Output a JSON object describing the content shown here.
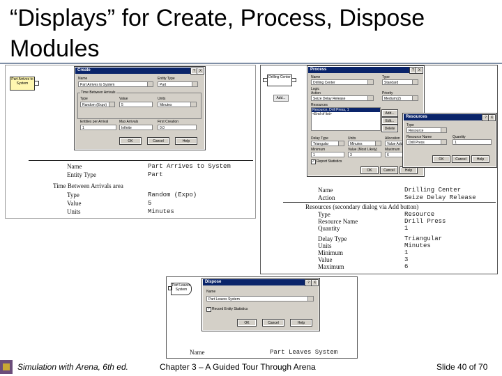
{
  "slide": {
    "title": "“Displays” for Create, Process, Dispose Modules",
    "footer_left": "Simulation with Arena, 6th ed.",
    "footer_center": "Chapter 3 – A Guided Tour Through Arena",
    "footer_right": "Slide 40 of 70"
  },
  "create_panel": {
    "module_label": "Part Arrives to System",
    "dialog": {
      "title": "Create",
      "help_btn": "?",
      "close_btn": "X",
      "name_label": "Name",
      "name_value": "Part Arrives to System",
      "entity_type_label": "Entity Type",
      "entity_type_value": "Part",
      "group_label": "Time Between Arrivals",
      "type_label": "Type",
      "type_value": "Random (Expo)",
      "value_label": "Value",
      "value_value": "5",
      "units_label": "Units",
      "units_value": "Minutes",
      "entities_label": "Entities per Arrival",
      "entities_value": "1",
      "max_label": "Max Arrivals",
      "max_value": "Infinite",
      "first_label": "First Creation",
      "first_value": "0.0",
      "ok": "OK",
      "cancel": "Cancel",
      "help": "Help"
    },
    "table": {
      "rows": [
        {
          "label": "Name",
          "value": "Part Arrives to System"
        },
        {
          "label": "Entity Type",
          "value": "Part"
        },
        {
          "label": "Time Between Arrivals area",
          "value": ""
        },
        {
          "label": "Type",
          "value": "Random (Expo)"
        },
        {
          "label": "Value",
          "value": "5"
        },
        {
          "label": "Units",
          "value": "Minutes"
        }
      ]
    }
  },
  "process_panel": {
    "module_label": "Drilling Center",
    "add_button": "Add...",
    "dialog": {
      "title": "Process",
      "help_btn": "?",
      "close_btn": "X",
      "name_label": "Name",
      "name_value": "Drilling Center",
      "type_label": "Type",
      "type_value": "Standard",
      "logic_label": "Logic",
      "action_label": "Action",
      "action_value": "Seize Delay Release",
      "priority_label": "Priority",
      "priority_value": "Medium(2)",
      "resources_label": "Resources",
      "resources_items": [
        "Resource, Drill Press, 1",
        "<End of list>"
      ],
      "add": "Add...",
      "edit": "Edit...",
      "delete": "Delete",
      "delay_type_label": "Delay Type",
      "delay_type_value": "Triangular",
      "units_label": "Units",
      "units_value": "Minutes",
      "allocation_label": "Allocation",
      "allocation_value": "Value Added",
      "minimum_label": "Minimum",
      "minimum_value": "1",
      "value_label": "Value (Most Likely)",
      "value_value": "3",
      "maximum_label": "Maximum",
      "maximum_value": "6",
      "report_label": "Report Statistics",
      "ok": "OK",
      "cancel": "Cancel",
      "help": "Help"
    },
    "resources_dialog": {
      "title": "Resources",
      "help_btn": "?",
      "close_btn": "X",
      "type_label": "Type",
      "type_value": "Resource",
      "name_label": "Resource Name",
      "name_value": "Drill Press",
      "quantity_label": "Quantity",
      "quantity_value": "1",
      "ok": "OK",
      "cancel": "Cancel",
      "help": "Help"
    },
    "table": {
      "rows_top": [
        {
          "label": "Name",
          "value": "Drilling Center"
        },
        {
          "label": "Action",
          "value": "Seize Delay Release"
        }
      ],
      "resources_caption": "Resources (secondary dialog via Add button)",
      "rows_res": [
        {
          "label": "Type",
          "value": "Resource"
        },
        {
          "label": "Resource Name",
          "value": "Drill Press"
        },
        {
          "label": "Quantity",
          "value": "1"
        }
      ],
      "rows_delay": [
        {
          "label": "Delay Type",
          "value": "Triangular"
        },
        {
          "label": "Units",
          "value": "Minutes"
        },
        {
          "label": "Minimum",
          "value": "1"
        },
        {
          "label": "Value",
          "value": "3"
        },
        {
          "label": "Maximum",
          "value": "6"
        }
      ]
    }
  },
  "dispose_panel": {
    "module_label": "Part Leaves System",
    "dialog": {
      "title": "Dispose",
      "help_btn": "?",
      "close_btn": "X",
      "name_label": "Name",
      "name_value": "Part Leaves System",
      "record_label": "Record Entity Statistics",
      "ok": "OK",
      "cancel": "Cancel",
      "help": "Help"
    },
    "table": {
      "rows": [
        {
          "label": "Name",
          "value": "Part Leaves System"
        }
      ]
    }
  }
}
